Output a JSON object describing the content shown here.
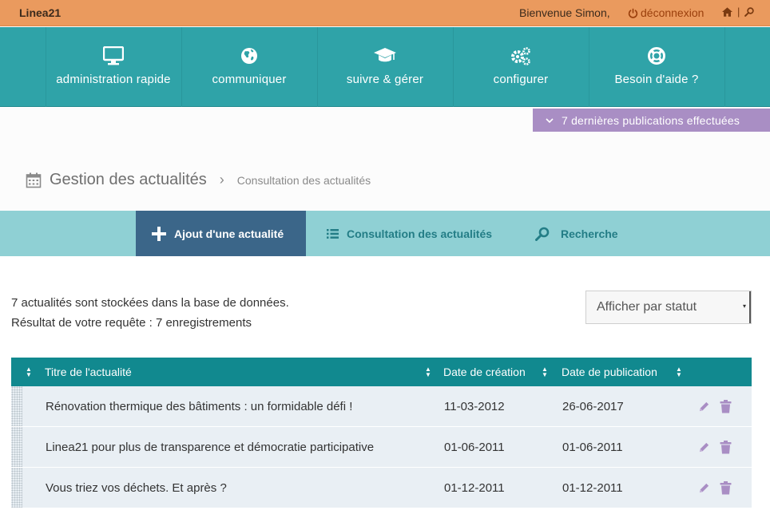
{
  "topbar": {
    "brand": "Linea21",
    "welcome": "Bienvenue Simon,",
    "logout_label": "déconnexion",
    "separator": "|"
  },
  "mainnav": {
    "items": [
      {
        "label": "administration rapide",
        "icon": "monitor-icon"
      },
      {
        "label": "communiquer",
        "icon": "globe-icon"
      },
      {
        "label": "suivre & gérer",
        "icon": "graduation-cap-icon"
      },
      {
        "label": "configurer",
        "icon": "gears-icon"
      },
      {
        "label": "Besoin d'aide ?",
        "icon": "lifebuoy-icon"
      }
    ]
  },
  "publications": {
    "label": "7 dernières publications effectuées"
  },
  "page": {
    "title": "Gestion des actualités",
    "breadcrumb_current": "Consultation des actualités"
  },
  "subnav": {
    "add_label": "Ajout d'une actualité",
    "list_label": "Consultation des actualités",
    "search_label": "Recherche"
  },
  "summary": {
    "line1": "7 actualités sont stockées dans la base de données.",
    "line2": "Résultat de votre requête : 7 enregistrements"
  },
  "filter": {
    "selected": "Afficher par statut"
  },
  "table": {
    "headers": {
      "title": "Titre de l'actualité",
      "created": "Date de création",
      "published": "Date de publication"
    },
    "rows": [
      {
        "title": "Rénovation thermique des bâtiments : un formidable défi !",
        "created": "11-03-2012",
        "published": "26-06-2017"
      },
      {
        "title": "Linea21 pour plus de transparence et démocratie participative",
        "created": "01-06-2011",
        "published": "01-06-2011"
      },
      {
        "title": "Vous triez vos déchets. Et après ?",
        "created": "01-12-2011",
        "published": "01-12-2011"
      }
    ]
  },
  "colors": {
    "topbar": "#ea9a5e",
    "nav": "#2fa3a8",
    "subbar": "#8fd0d4",
    "active_tab": "#3b6689",
    "table_header": "#11898f",
    "publications": "#a98ec4",
    "action_icons": "#a98ec4"
  }
}
